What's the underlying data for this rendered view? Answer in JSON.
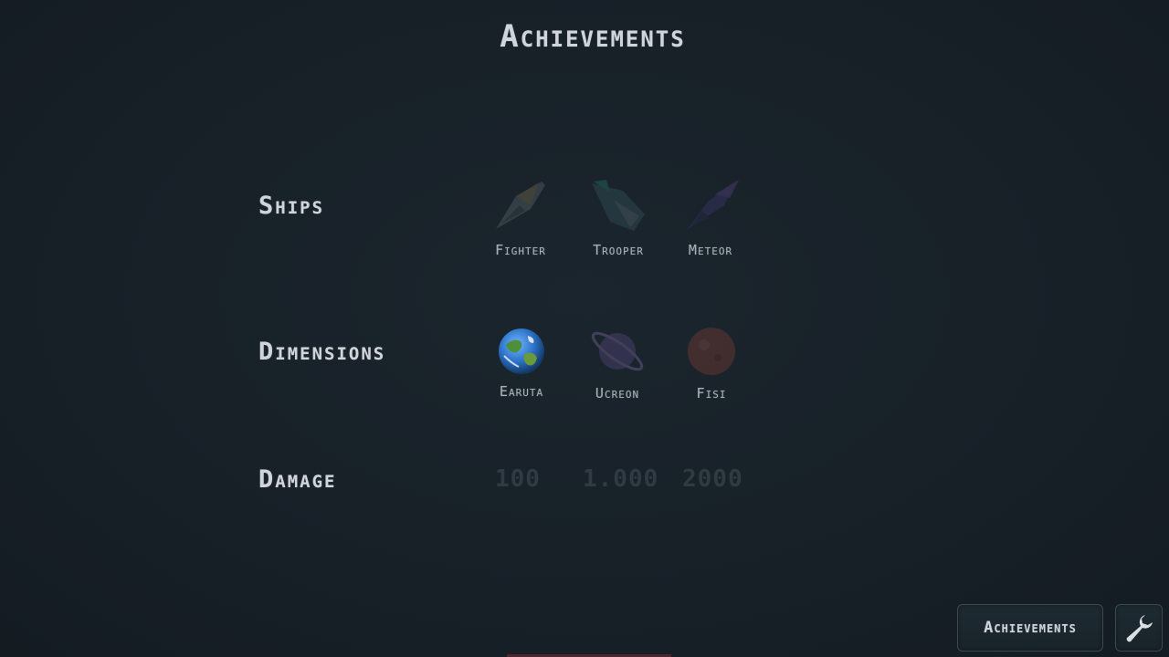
{
  "header": {
    "title": "Achievements"
  },
  "ships": {
    "label": "Ships",
    "items": [
      {
        "name": "Fighter",
        "icon": "fighter-ship-icon",
        "unlocked": false
      },
      {
        "name": "Trooper",
        "icon": "trooper-ship-icon",
        "unlocked": false
      },
      {
        "name": "Meteor",
        "icon": "meteor-ship-icon",
        "unlocked": false
      }
    ]
  },
  "dimensions": {
    "label": "Dimensions",
    "items": [
      {
        "name": "Earuta",
        "icon": "earth-planet-icon",
        "unlocked": true
      },
      {
        "name": "Ucreon",
        "icon": "ringed-planet-icon",
        "unlocked": false
      },
      {
        "name": "Fisi",
        "icon": "red-planet-icon",
        "unlocked": false
      }
    ]
  },
  "damage": {
    "label": "Damage",
    "values": [
      "100",
      "1.000",
      "2000"
    ]
  },
  "footer": {
    "achievements_label": "Achievements",
    "settings_icon": "wrench-icon"
  },
  "colors": {
    "background": "#172027",
    "text": "#cfd5da",
    "locked_text": "#3b454d",
    "border": "#3b4952"
  }
}
